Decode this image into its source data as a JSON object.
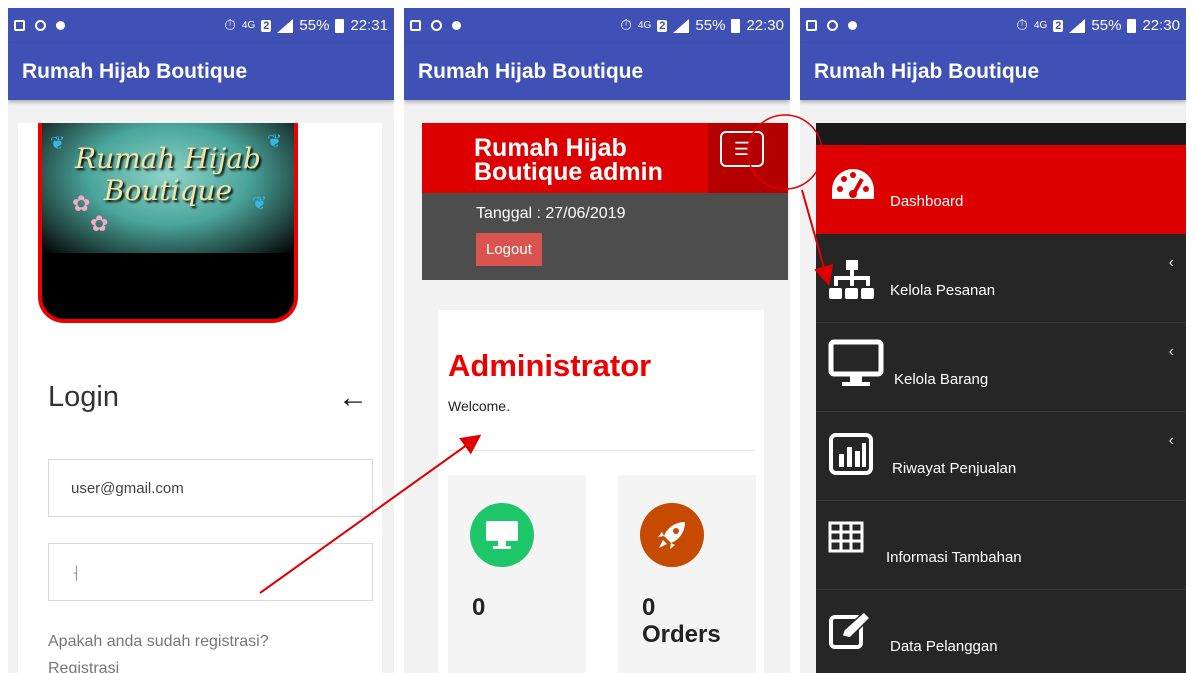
{
  "status_bar": {
    "phone1": {
      "network": "4G",
      "sim": "2",
      "battery": "55%",
      "time": "22:31"
    },
    "phone2": {
      "network": "4G",
      "sim": "2",
      "battery": "55%",
      "time": "22:30"
    },
    "phone3": {
      "network": "4G",
      "sim": "2",
      "battery": "55%",
      "time": "22:30"
    }
  },
  "app_title": "Rumah Hijab Boutique",
  "login": {
    "logo_line1": "Rumah Hijab",
    "logo_line2": "Boutique",
    "title": "Login",
    "email_value": "user@gmail.com",
    "password_value": "",
    "register_question": "Apakah anda sudah registrasi?",
    "register_link": "Registrasi"
  },
  "admin": {
    "header_line1": "Rumah Hijab",
    "header_line2": "Boutique admin",
    "date_text": "Tanggal : 27/06/2019",
    "logout_label": "Logout",
    "page_title": "Administrator",
    "welcome": "Welcome.",
    "stats": [
      {
        "value": "0",
        "label": "",
        "color": "#1ec66a",
        "icon": "monitor-icon"
      },
      {
        "value": "0",
        "label": "Orders",
        "color": "#c64a00",
        "icon": "rocket-icon"
      }
    ]
  },
  "drawer": {
    "items": [
      {
        "label": "Dashboard",
        "icon": "dashboard-gauge-icon",
        "active": true
      },
      {
        "label": "Kelola Pesanan",
        "icon": "sitemap-icon",
        "chevron": "‹"
      },
      {
        "label": "Kelola Barang",
        "icon": "monitor-icon",
        "chevron": "‹"
      },
      {
        "label": "Riwayat Penjualan",
        "icon": "bar-chart-icon",
        "chevron": "‹"
      },
      {
        "label": "Informasi Tambahan",
        "icon": "table-icon"
      },
      {
        "label": "Data Pelanggan",
        "icon": "edit-icon"
      }
    ]
  },
  "colors": {
    "primary": "#3f51b5",
    "admin_red": "#dd0000",
    "logout": "#d9534f",
    "drawer_bg": "#262626",
    "annotation": "#e00000"
  }
}
